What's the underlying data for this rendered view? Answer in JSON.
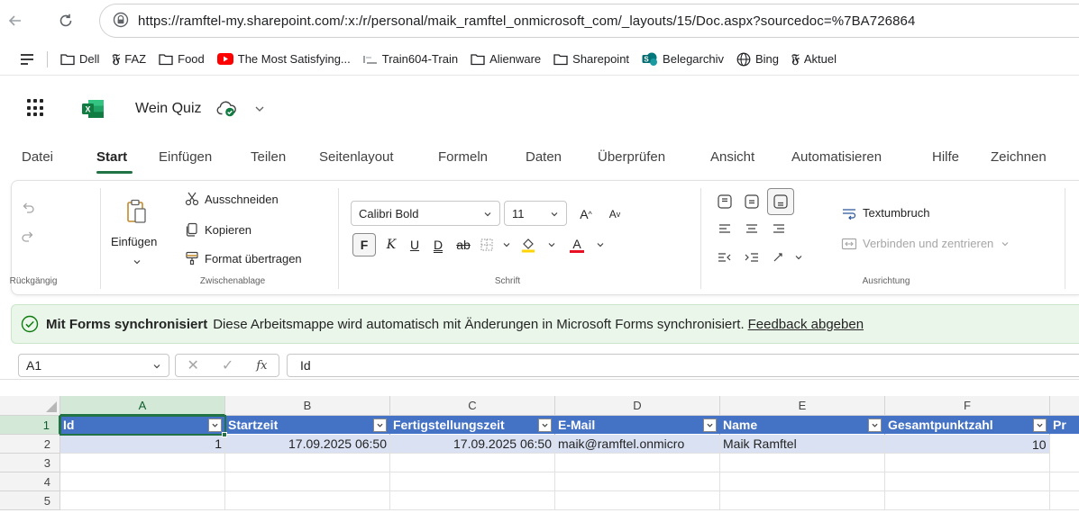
{
  "browser": {
    "url": "https://ramftel-my.sharepoint.com/:x:/r/personal/maik_ramftel_onmicrosoft_com/_layouts/15/Doc.aspx?sourcedoc=%7BA726864"
  },
  "bookmarks": [
    {
      "label": "Dell",
      "icon": "folder-icon"
    },
    {
      "label": "FAZ",
      "icon": "faz-icon"
    },
    {
      "label": "Food",
      "icon": "folder-icon"
    },
    {
      "label": "The Most Satisfying...",
      "icon": "youtube-icon"
    },
    {
      "label": "Train604-Train",
      "icon": "train-icon"
    },
    {
      "label": "Alienware",
      "icon": "folder-icon"
    },
    {
      "label": "Sharepoint",
      "icon": "folder-icon"
    },
    {
      "label": "Belegarchiv",
      "icon": "sharepoint-icon"
    },
    {
      "label": "Bing",
      "icon": "globe-icon"
    },
    {
      "label": "Aktuel",
      "icon": "faz-icon"
    }
  ],
  "app": {
    "doc_title": "Wein Quiz"
  },
  "menu": {
    "tabs": [
      "Datei",
      "Start",
      "Einfügen",
      "Teilen",
      "Seitenlayout",
      "Formeln",
      "Daten",
      "Überprüfen",
      "Ansicht",
      "Automatisieren",
      "Hilfe",
      "Zeichnen"
    ],
    "active": "Start"
  },
  "ribbon": {
    "undo_group": "Rückgängig",
    "paste_label": "Einfügen",
    "clipboard": {
      "cut": "Ausschneiden",
      "copy": "Kopieren",
      "format_painter": "Format übertragen",
      "group": "Zwischenablage"
    },
    "font": {
      "name": "Calibri Bold",
      "size": "11",
      "bold": "F",
      "italic": "K",
      "underline": "U",
      "double_underline": "D",
      "strike": "ab",
      "font_color_letter": "A",
      "group": "Schrift"
    },
    "alignment": {
      "wrap": "Textumbruch",
      "merge": "Verbinden und zentrieren",
      "group": "Ausrichtung"
    },
    "colors": {
      "fill_bar": "#ffd400",
      "font_bar": "#e81123"
    }
  },
  "banner": {
    "title": "Mit Forms synchronisiert",
    "message": "Diese Arbeitsmappe wird automatisch mit Änderungen in Microsoft Forms synchronisiert.",
    "link": "Feedback abgeben"
  },
  "formula_bar": {
    "cell_ref": "A1",
    "fx": "fx",
    "value": "Id"
  },
  "sheet": {
    "columns": [
      "A",
      "B",
      "C",
      "D",
      "E",
      "F"
    ],
    "rows": [
      "1",
      "2",
      "3",
      "4",
      "5"
    ],
    "headers": [
      "Id",
      "Startzeit",
      "Fertigstellungszeit",
      "E-Mail",
      "Name",
      "Gesamtpunktzahl",
      "Pr"
    ],
    "row2": [
      "1",
      "17.09.2025 06:50",
      "17.09.2025 06:50",
      "maik@ramftel.onmicro",
      "Maik Ramftel",
      "",
      "10"
    ],
    "header_color": "#4472c4",
    "band_color": "#d9e1f2",
    "accent": "#217346"
  }
}
